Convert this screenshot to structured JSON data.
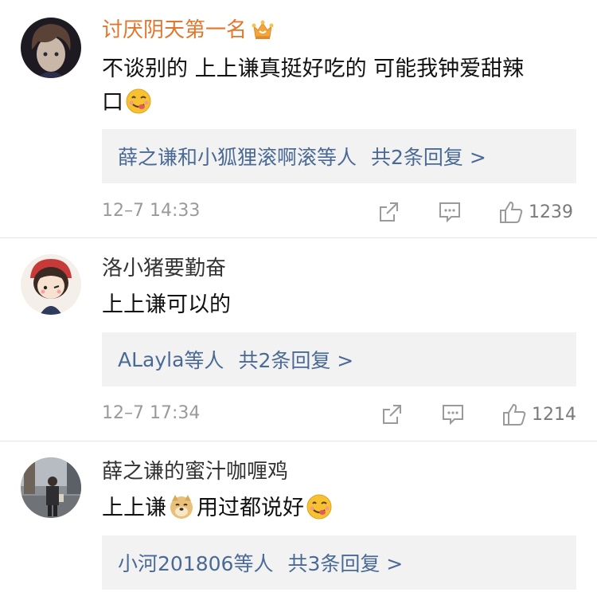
{
  "comments": [
    {
      "username": "讨厌阴天第一名",
      "content_line1": "不谈别的 上上谦真挺好吃的 可能我钟爱甜辣",
      "content_line2": "口",
      "reply_users": "薛之谦和小狐狸滚啊滚",
      "reply_deng": "等人",
      "reply_count": "共2条回复 >",
      "time": "12–7 14:33",
      "likes": "1239",
      "icons": [
        "avatar-boy",
        "crown-icon",
        "yum-emoji-icon",
        "share-icon",
        "comment-icon",
        "like-icon"
      ]
    },
    {
      "username": "洛小猪要勤奋",
      "content": "上上谦可以的",
      "reply_users": "ALayla",
      "reply_deng": "等人",
      "reply_count": "共2条回复 >",
      "time": "12–7 17:34",
      "likes": "1214",
      "icons": [
        "avatar-girl",
        "share-icon",
        "comment-icon",
        "like-icon"
      ]
    },
    {
      "username": "薛之谦的蜜汁咖喱鸡",
      "content_part1": "上上谦",
      "content_part2": "用过都说好",
      "reply_users": "小河201806",
      "reply_deng": "等人",
      "reply_count": "共3条回复 >",
      "icons": [
        "avatar-street-photo",
        "doge-emoji-icon",
        "yum-emoji-icon"
      ]
    }
  ],
  "colors": {
    "vip_name": "#e1762c",
    "reply_link": "#4a6a95",
    "reply_bg": "#f2f2f2",
    "meta_gray": "#9a9a9a"
  }
}
